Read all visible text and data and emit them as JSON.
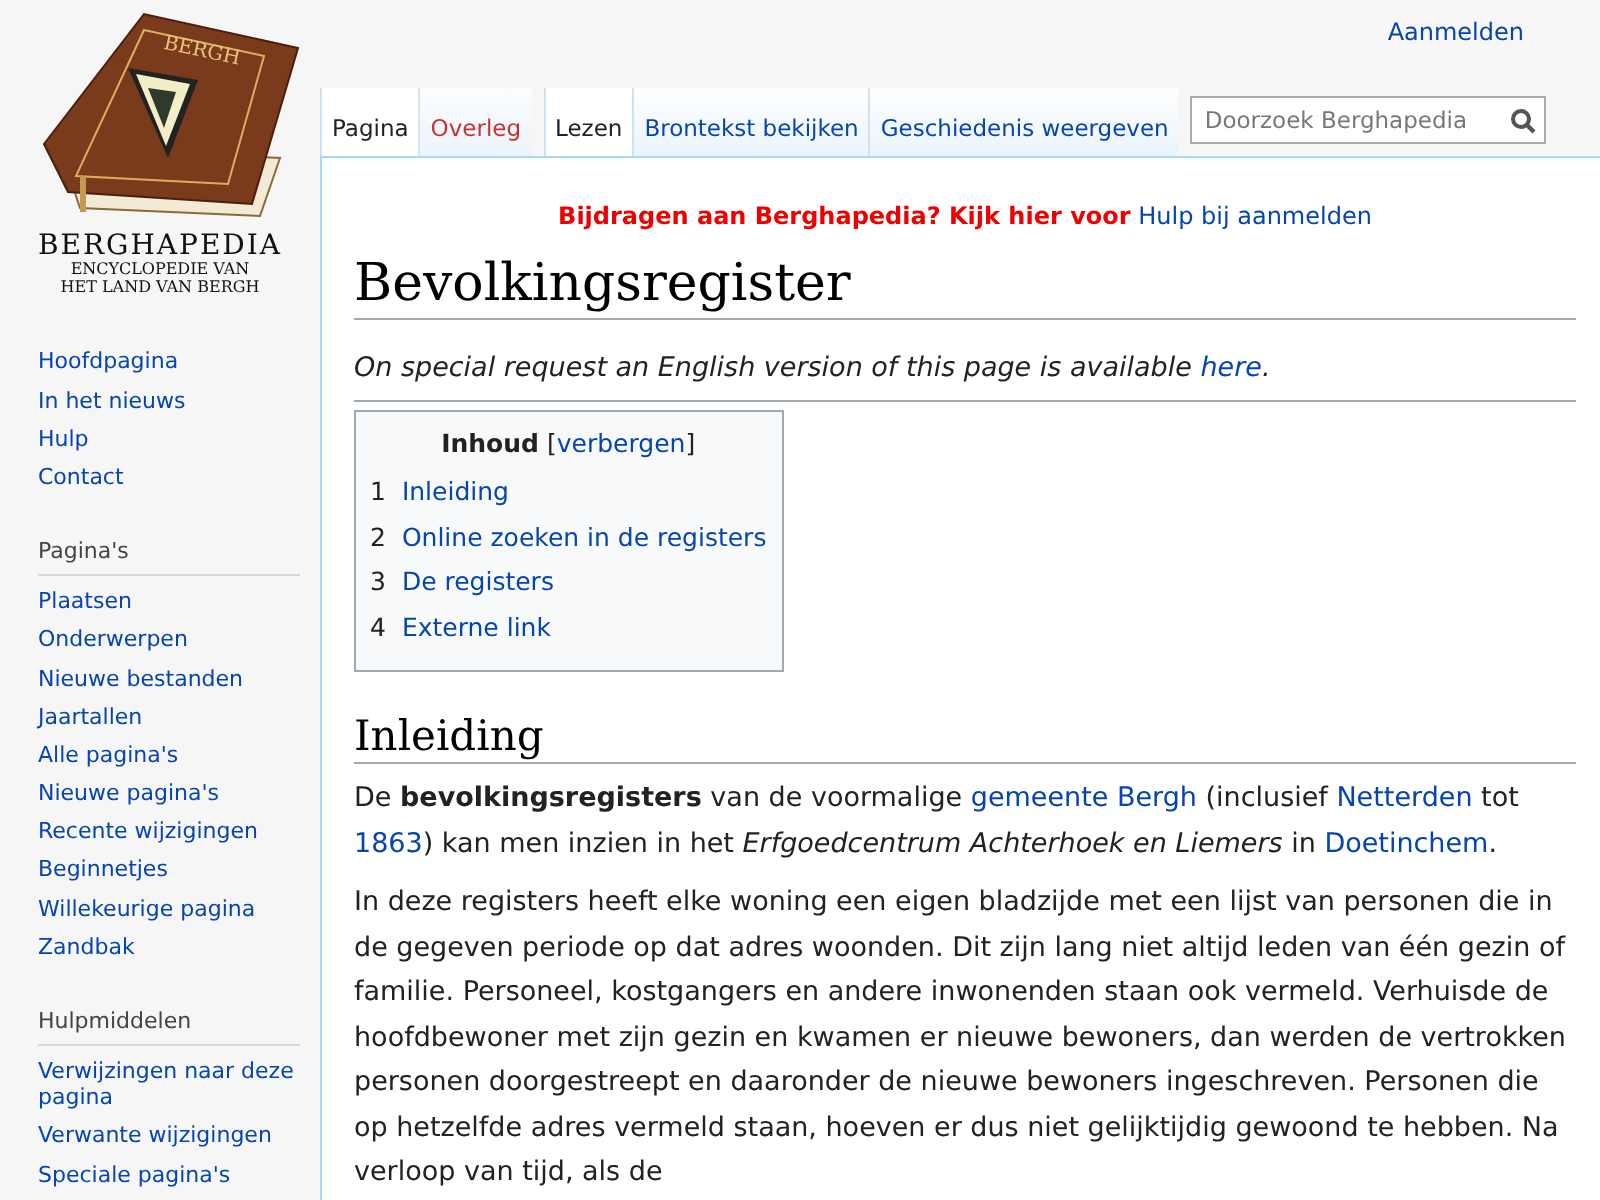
{
  "logo": {
    "book_title": "BERGH",
    "name": "BERGHAPEDIA",
    "tagline_1": "ENCYCLOPEDIE VAN",
    "tagline_2": "HET LAND VAN BERGH"
  },
  "personal": {
    "login": "Aanmelden"
  },
  "namespace_tabs": [
    {
      "label": "Pagina",
      "selected": true,
      "page_exists": true
    },
    {
      "label": "Overleg",
      "selected": false,
      "page_exists": false
    }
  ],
  "view_tabs": [
    {
      "label": "Lezen",
      "selected": true
    },
    {
      "label": "Brontekst bekijken",
      "selected": false
    },
    {
      "label": "Geschiedenis weergeven",
      "selected": false
    }
  ],
  "search": {
    "placeholder": "Doorzoek Berghapedia"
  },
  "sidebar": {
    "portals": [
      {
        "items": [
          "Hoofdpagina",
          "In het nieuws",
          "Hulp",
          "Contact"
        ]
      },
      {
        "heading": "Pagina's",
        "items": [
          "Plaatsen",
          "Onderwerpen",
          "Nieuwe bestanden",
          "Jaartallen",
          "Alle pagina's",
          "Nieuwe pagina's",
          "Recente wijzigingen",
          "Beginnetjes",
          "Willekeurige pagina",
          "Zandbak"
        ]
      },
      {
        "heading": "Hulpmiddelen",
        "items": [
          "Verwijzingen naar deze pagina",
          "Verwante wijzigingen",
          "Speciale pagina's"
        ]
      }
    ]
  },
  "sitenotice": {
    "text": "Bijdragen aan Berghapedia? Kijk hier voor",
    "link": "Hulp bij aanmelden"
  },
  "title": "Bevolkingsregister",
  "hatnote": [
    {
      "kind": "text",
      "text": "On special request an English version of this page is available "
    },
    {
      "kind": "link",
      "text": "here"
    },
    {
      "kind": "text",
      "text": "."
    }
  ],
  "toc": {
    "title": "Inhoud",
    "toggle_open": "[",
    "toggle": "verbergen",
    "toggle_close": "]",
    "entries": [
      {
        "number": "1",
        "label": "Inleiding"
      },
      {
        "number": "2",
        "label": "Online zoeken in de registers"
      },
      {
        "number": "3",
        "label": "De registers"
      },
      {
        "number": "4",
        "label": "Externe link"
      }
    ]
  },
  "section_heading": "Inleiding",
  "paragraphs": [
    [
      {
        "kind": "text",
        "text": "De "
      },
      {
        "kind": "bold",
        "text": "bevolkingsregisters"
      },
      {
        "kind": "text",
        "text": " van de voormalige "
      },
      {
        "kind": "link",
        "text": "gemeente Bergh"
      },
      {
        "kind": "text",
        "text": " (inclusief "
      },
      {
        "kind": "link",
        "text": "Netterden"
      },
      {
        "kind": "text",
        "text": " tot "
      },
      {
        "kind": "link",
        "text": "1863"
      },
      {
        "kind": "text",
        "text": ") kan men inzien in het "
      },
      {
        "kind": "italic",
        "text": "Erfgoedcentrum Achterhoek en Liemers"
      },
      {
        "kind": "text",
        "text": " in "
      },
      {
        "kind": "link",
        "text": "Doetinchem"
      },
      {
        "kind": "text",
        "text": "."
      }
    ],
    [
      {
        "kind": "text",
        "text": "In deze registers heeft elke woning een eigen bladzijde met een lijst van personen die in de gegeven periode op dat adres woonden. Dit zijn lang niet altijd leden van één gezin of familie. Personeel, kostgangers en andere inwonenden staan ook vermeld. Verhuisde de hoofdbewoner met zijn gezin en kwamen er nieuwe bewoners, dan werden de vertrokken personen doorgestreept en daaronder de nieuwe bewoners ingeschreven. Personen die op hetzelfde adres vermeld staan, hoeven er dus niet gelijktijdig gewoond te hebben. Na verloop van tijd, als de"
      }
    ]
  ]
}
